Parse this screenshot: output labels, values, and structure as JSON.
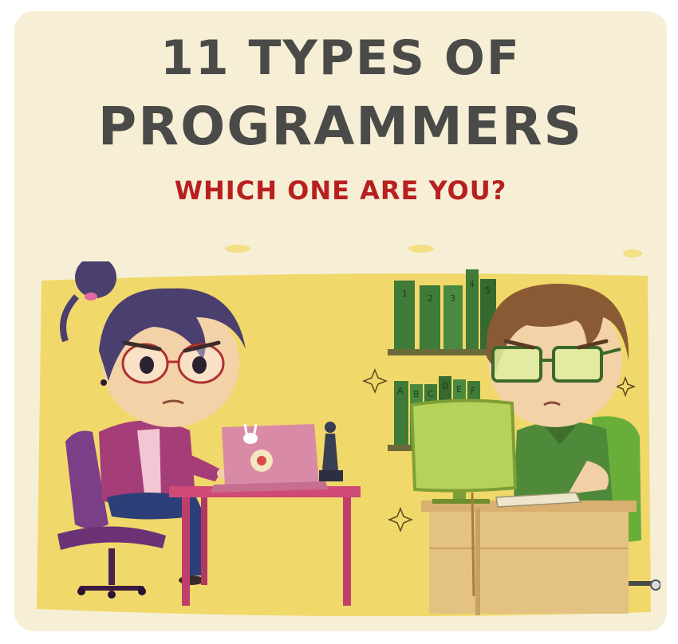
{
  "header": {
    "title_line1": "11 TYPES OF",
    "title_line2": "PROGRAMMERS",
    "subtitle": "WHICH ONE ARE YOU?"
  },
  "illustration": {
    "shelf_top_books": [
      "1",
      "2",
      "3",
      "4",
      "5"
    ],
    "shelf_bottom_books": [
      "A",
      "B",
      "C",
      "D",
      "E",
      "F"
    ]
  },
  "colors": {
    "card_background": "#f6efd6",
    "wall_yellow": "#f1d86a",
    "title_gray": "#4a4a48",
    "subtitle_red": "#b82020",
    "book_green": "#3f7a36"
  }
}
